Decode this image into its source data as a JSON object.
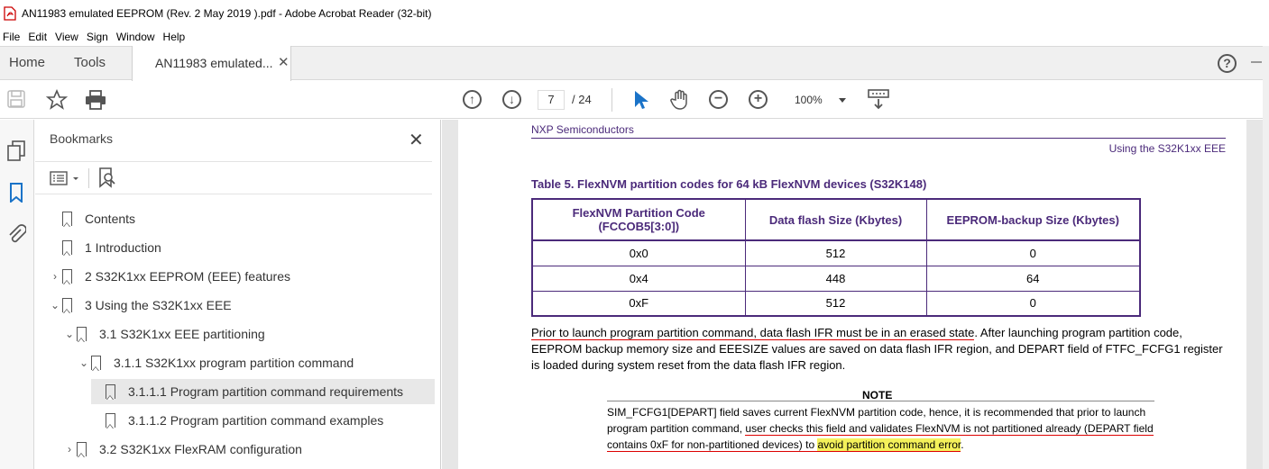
{
  "window": {
    "title": "AN11983 emulated EEPROM (Rev. 2  May 2019 ).pdf - Adobe Acrobat Reader (32-bit)"
  },
  "menu": [
    "File",
    "Edit",
    "View",
    "Sign",
    "Window",
    "Help"
  ],
  "tabs": {
    "home": "Home",
    "tools": "Tools",
    "document": "AN11983 emulated...",
    "close": "✕"
  },
  "toolbar": {
    "current_page": "7",
    "page_total": "/ 24",
    "zoom": "100%"
  },
  "bookmarks": {
    "title": "Bookmarks",
    "close": "✕",
    "items": [
      {
        "label": "Contents",
        "chevron": ""
      },
      {
        "label": "1 Introduction",
        "chevron": ""
      },
      {
        "label": "2 S32K1xx EEPROM (EEE) features",
        "chevron": "›"
      },
      {
        "label": "3 Using the S32K1xx EEE",
        "chevron": "⌄"
      },
      {
        "label": "3.1 S32K1xx EEE partitioning",
        "chevron": "⌄"
      },
      {
        "label": "3.1.1 S32K1xx program partition command",
        "chevron": "⌄"
      },
      {
        "label": "3.1.1.1 Program partition command requirements",
        "chevron": ""
      },
      {
        "label": "3.1.1.2 Program partition command examples",
        "chevron": ""
      },
      {
        "label": "3.2 S32K1xx FlexRAM configuration",
        "chevron": "›"
      }
    ]
  },
  "document": {
    "header_left": "NXP Semiconductors",
    "header_right": "Using the S32K1xx EEE",
    "table_caption": "Table 5.  FlexNVM partition codes for 64 kB FlexNVM devices (S32K148)",
    "table": {
      "headers": [
        "FlexNVM Partition Code (FCCOB5[3:0])",
        "Data flash Size (Kbytes)",
        "EEPROM-backup Size (Kbytes)"
      ],
      "rows": [
        [
          "0x0",
          "512",
          "0"
        ],
        [
          "0x4",
          "448",
          "64"
        ],
        [
          "0xF",
          "512",
          "0"
        ]
      ]
    },
    "paragraph_underlined": "Prior to launch program partition command, data flash IFR must be in an erased state",
    "paragraph_rest": ". After launching program partition code, EEPROM backup memory size and EEESIZE values are saved on data flash IFR region, and DEPART field of FTFC_FCFG1 register is loaded during system reset from the data flash IFR region.",
    "note_title": "NOTE",
    "note_part1": "SIM_FCFG1[DEPART] field saves current FlexNVM partition code, hence, it is recommended that prior to launch program partition command, ",
    "note_underlined": "user checks this field and validates FlexNVM is not partitioned already (DEPART field contains 0xF for non-partitioned devices) to ",
    "note_highlight": "avoid partition command error",
    "note_end": "."
  },
  "colors": {
    "nxp_purple": "#4b2a7a",
    "highlight": "#f4f15a",
    "underline": "#dd0000"
  }
}
